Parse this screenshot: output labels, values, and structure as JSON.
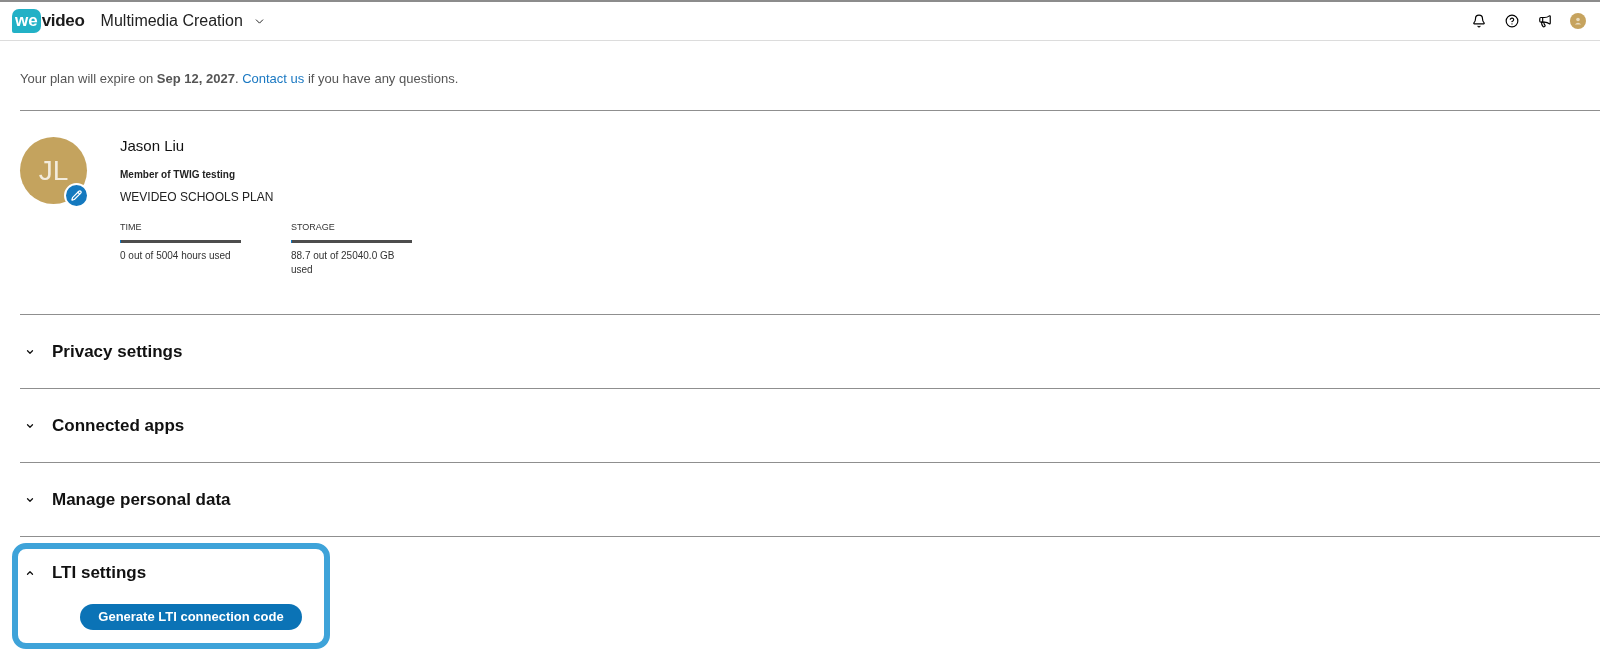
{
  "header": {
    "logo": {
      "mark": "we",
      "text": "video"
    },
    "workspace": "Multimedia Creation"
  },
  "notice": {
    "text": "Your plan will expire on **Sep 12, 2027**.",
    "link": "Contact us",
    "text_after": "if you have any questions."
  },
  "profile": {
    "initials": "JL",
    "name": "Jason Liu",
    "group": "Member of TWIG testing",
    "plan": "WEVIDEO SCHOOLS PLAN",
    "usage": [
      {
        "label": "TIME",
        "level": 0,
        "reading": "0 out of 5004 hours used"
      },
      {
        "label": "STORAGE",
        "level": 0.004,
        "reading": "88.7 out of 25040.0 GB used"
      }
    ]
  },
  "sections": [
    {
      "title": "Privacy settings",
      "expanded": false,
      "highlighted": false
    },
    {
      "title": "Connected apps",
      "expanded": false,
      "highlighted": false
    },
    {
      "title": "Manage personal data",
      "expanded": false,
      "highlighted": false
    },
    {
      "title": "LTI settings",
      "expanded": true,
      "highlighted": true,
      "button": "Generate LTI connection code"
    }
  ]
}
